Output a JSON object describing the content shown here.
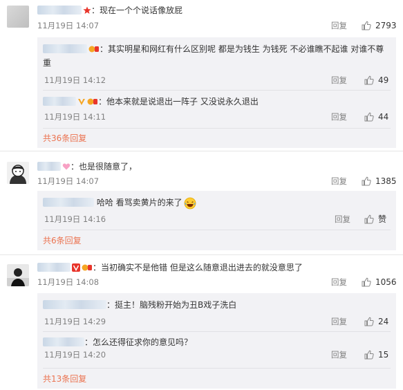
{
  "ui": {
    "reply_label": "回复",
    "like_icon": "thumb-up-icon",
    "accent": "#eb7350"
  },
  "comments": [
    {
      "text": "：现在一个个说话像放屁",
      "time": "11月19日 14:07",
      "likes": "2793",
      "replies": [
        {
          "text": "：其实明星和网红有什么区别呢 都是为钱生 为钱死 不必谁瞧不起谁 对谁不尊重",
          "time": "11月19日 14:12",
          "likes": "49"
        },
        {
          "text": "：他本来就是说退出一阵子 又没说永久退出",
          "time": "11月19日 14:11",
          "likes": "44"
        }
      ],
      "more": "共36条回复"
    },
    {
      "text": "：也是很随意了，",
      "time": "11月19日 14:07",
      "likes": "1385",
      "replies": [
        {
          "text": "哈哈 看骂卖黄片的来了",
          "time": "11月19日 14:16",
          "likes": "赞"
        }
      ],
      "more": "共6条回复"
    },
    {
      "text": "：当初确实不是他错 但是这么随意退出进去的就没意思了",
      "time": "11月19日 14:08",
      "likes": "1056",
      "replies": [
        {
          "text": "：挺主！脑残粉开始为丑B戏子洗白",
          "time": "11月19日 14:29",
          "likes": "24"
        },
        {
          "text": "：怎么还得征求你的意见吗？",
          "time": "11月19日 14:20",
          "likes": "15"
        }
      ],
      "more": "共13条回复"
    }
  ]
}
